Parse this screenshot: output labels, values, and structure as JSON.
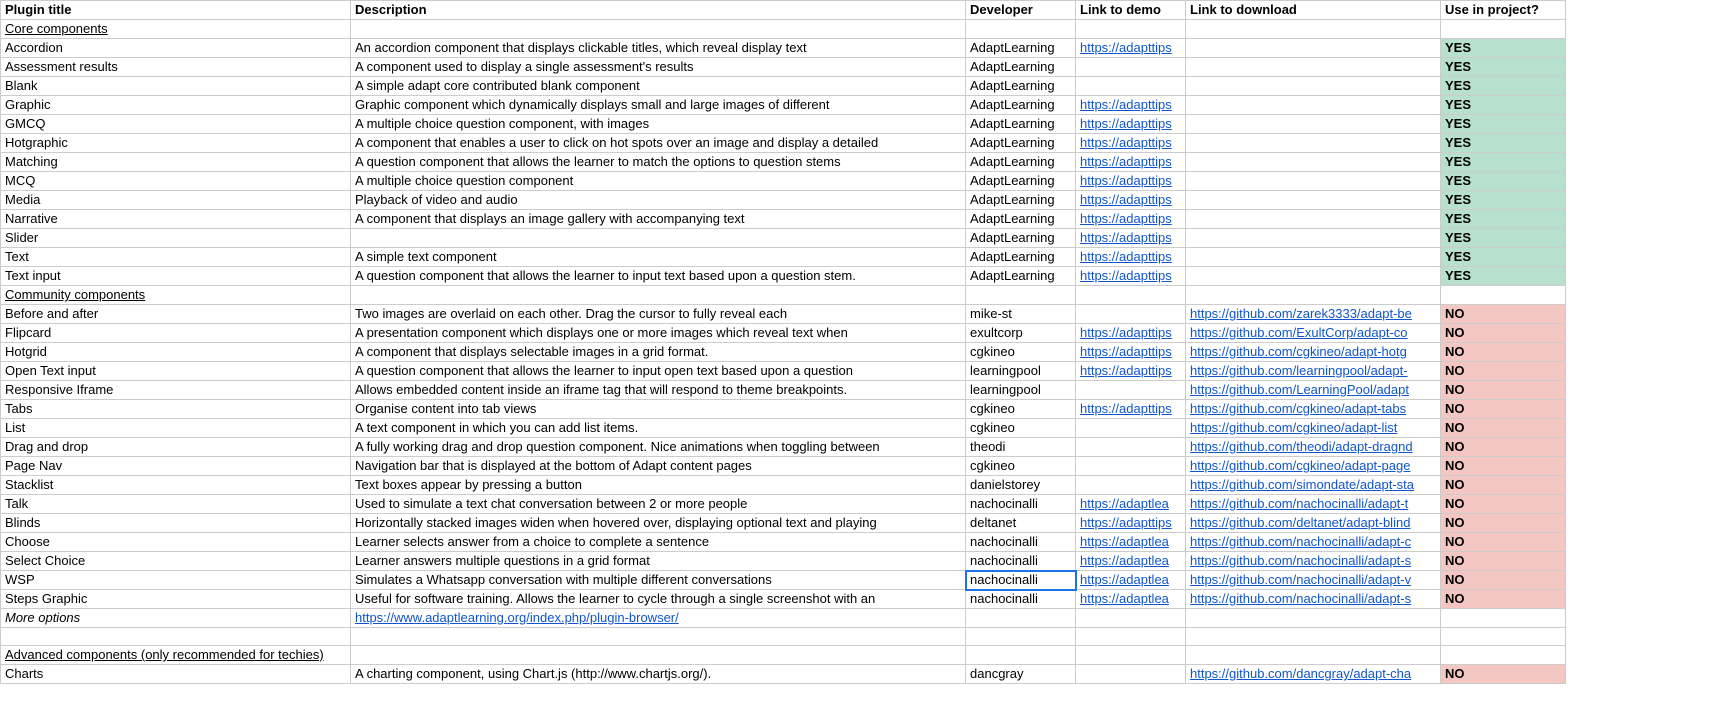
{
  "headers": {
    "title": "Plugin title",
    "description": "Description",
    "developer": "Developer",
    "demo": "Link to demo",
    "download": "Link to download",
    "use": "Use in project?"
  },
  "sections": {
    "core": "Core components",
    "community": "Community components",
    "more_options": "More options",
    "advanced": "Advanced components (only recommended for techies)"
  },
  "more_options_link": "https://www.adaptlearning.org/index.php/plugin-browser/",
  "rows": {
    "core": [
      {
        "title": "Accordion",
        "desc": "An accordion component that displays clickable titles, which reveal display text",
        "dev": "AdaptLearning",
        "demo": "https://adapttips",
        "down": "",
        "use": "YES"
      },
      {
        "title": "Assessment results",
        "desc": "A component used to display a single assessment's results",
        "dev": "AdaptLearning",
        "demo": "",
        "down": "",
        "use": "YES"
      },
      {
        "title": "Blank",
        "desc": "A simple adapt core contributed blank component",
        "dev": "AdaptLearning",
        "demo": "",
        "down": "",
        "use": "YES"
      },
      {
        "title": "Graphic",
        "desc": "Graphic component which dynamically displays small and large images of different",
        "dev": "AdaptLearning",
        "demo": "https://adapttips",
        "down": "",
        "use": "YES"
      },
      {
        "title": "GMCQ",
        "desc": "A multiple choice question component, with images",
        "dev": "AdaptLearning",
        "demo": "https://adapttips",
        "down": "",
        "use": "YES"
      },
      {
        "title": "Hotgraphic",
        "desc": "A component that enables a user to click on hot spots over an image and display a detailed",
        "dev": "AdaptLearning",
        "demo": "https://adapttips",
        "down": "",
        "use": "YES"
      },
      {
        "title": "Matching",
        "desc": "A question component that allows the learner to match the options to question stems",
        "dev": "AdaptLearning",
        "demo": "https://adapttips",
        "down": "",
        "use": "YES"
      },
      {
        "title": "MCQ",
        "desc": "A multiple choice question component",
        "dev": "AdaptLearning",
        "demo": "https://adapttips",
        "down": "",
        "use": "YES"
      },
      {
        "title": "Media",
        "desc": "Playback of video and audio",
        "dev": "AdaptLearning",
        "demo": "https://adapttips",
        "down": "",
        "use": "YES"
      },
      {
        "title": "Narrative",
        "desc": "A component that displays an image gallery with accompanying text",
        "dev": "AdaptLearning",
        "demo": "https://adapttips",
        "down": "",
        "use": "YES"
      },
      {
        "title": "Slider",
        "desc": "",
        "dev": "AdaptLearning",
        "demo": "https://adapttips",
        "down": "",
        "use": "YES"
      },
      {
        "title": "Text",
        "desc": "A simple text component",
        "dev": "AdaptLearning",
        "demo": "https://adapttips",
        "down": "",
        "use": "YES"
      },
      {
        "title": "Text input",
        "desc": "A question component that allows the learner to input text based upon a question stem.",
        "dev": "AdaptLearning",
        "demo": "https://adapttips",
        "down": "",
        "use": "YES"
      }
    ],
    "community": [
      {
        "title": "Before and after",
        "desc": "Two images are overlaid on each other. Drag the cursor to fully reveal each",
        "dev": "mike-st",
        "demo": "",
        "down": "https://github.com/zarek3333/adapt-be",
        "use": "NO"
      },
      {
        "title": "Flipcard",
        "desc": "A presentation component which displays one or more images which reveal text when",
        "dev": "exultcorp",
        "demo": "https://adapttips",
        "down": "https://github.com/ExultCorp/adapt-co",
        "use": "NO"
      },
      {
        "title": "Hotgrid",
        "desc": "A component that displays selectable images in a grid format.",
        "dev": "cgkineo",
        "demo": "https://adapttips",
        "down": "https://github.com/cgkineo/adapt-hotg",
        "use": "NO"
      },
      {
        "title": "Open Text input",
        "desc": "A question component that allows the learner to input open text based upon a question",
        "dev": "learningpool",
        "demo": "https://adapttips",
        "down": "https://github.com/learningpool/adapt-",
        "use": "NO"
      },
      {
        "title": "Responsive Iframe",
        "desc": "Allows embedded content inside an iframe tag that will respond to theme breakpoints.",
        "dev": "learningpool",
        "demo": "",
        "down": "https://github.com/LearningPool/adapt",
        "use": "NO"
      },
      {
        "title": "Tabs",
        "desc": "Organise content into tab views",
        "dev": "cgkineo",
        "demo": "https://adapttips",
        "down": "https://github.com/cgkineo/adapt-tabs",
        "use": "NO"
      },
      {
        "title": "List",
        "desc": "A text component in which you can add list items.",
        "dev": "cgkineo",
        "demo": "",
        "down": "https://github.com/cgkineo/adapt-list",
        "use": "NO"
      },
      {
        "title": "Drag and drop",
        "desc": "A fully working drag and drop question component. Nice animations when toggling between",
        "dev": "theodi",
        "demo": "",
        "down": "https://github.com/theodi/adapt-dragnd",
        "use": "NO"
      },
      {
        "title": "Page Nav",
        "desc": "Navigation bar that is displayed at the bottom of Adapt content pages",
        "dev": "cgkineo",
        "demo": "",
        "down": "https://github.com/cgkineo/adapt-page",
        "use": "NO"
      },
      {
        "title": "Stacklist",
        "desc": "Text boxes appear by pressing a button",
        "dev": "danielstorey",
        "demo": "",
        "down": "https://github.com/simondate/adapt-sta",
        "use": "NO"
      },
      {
        "title": "Talk",
        "desc": "Used to simulate a text chat conversation between 2 or more people",
        "dev": "nachocinalli",
        "demo": "https://adaptlea",
        "down": "https://github.com/nachocinalli/adapt-t",
        "use": "NO"
      },
      {
        "title": "Blinds",
        "desc": "Horizontally stacked images widen when hovered over, displaying optional text and playing",
        "dev": "deltanet",
        "demo": "https://adapttips",
        "down": "https://github.com/deltanet/adapt-blind",
        "use": "NO"
      },
      {
        "title": "Choose",
        "desc": "Learner selects answer from a choice to complete a sentence",
        "dev": "nachocinalli",
        "demo": "https://adaptlea",
        "down": "https://github.com/nachocinalli/adapt-c",
        "use": "NO"
      },
      {
        "title": "Select Choice",
        "desc": "Learner answers multiple questions in a grid format",
        "dev": "nachocinalli",
        "demo": "https://adaptlea",
        "down": "https://github.com/nachocinalli/adapt-s",
        "use": "NO"
      },
      {
        "title": "WSP",
        "desc": "Simulates a Whatsapp conversation with multiple different conversations",
        "dev": "nachocinalli",
        "demo": "https://adaptlea",
        "down": "https://github.com/nachocinalli/adapt-v",
        "use": "NO",
        "selected": true
      },
      {
        "title": "Steps Graphic",
        "desc": "Useful for software training. Allows the learner to cycle through a single screenshot with an",
        "dev": "nachocinalli",
        "demo": "https://adaptlea",
        "down": "https://github.com/nachocinalli/adapt-s",
        "use": "NO"
      }
    ],
    "advanced": [
      {
        "title": "Charts",
        "desc": "A charting component, using Chart.js (http://www.chartjs.org/).",
        "dev": "dancgray",
        "demo": "",
        "down": "https://github.com/dancgray/adapt-cha",
        "use": "NO"
      }
    ]
  }
}
